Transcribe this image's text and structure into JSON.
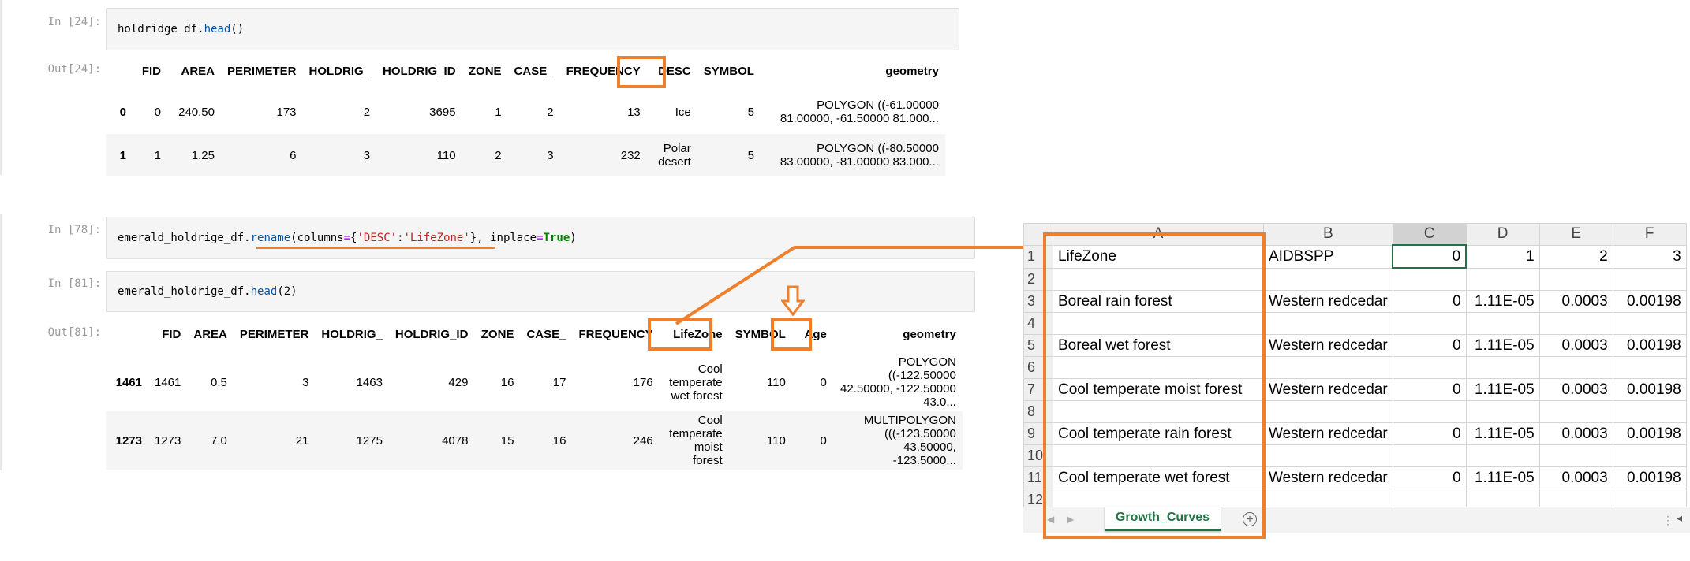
{
  "colors": {
    "highlight": "#f07f2b",
    "excel_green": "#217346"
  },
  "cell1": {
    "in_prompt": "In [24]:",
    "code": {
      "obj": "holdridge_df",
      "dot": ".",
      "fn": "head",
      "args": "()"
    },
    "out_prompt": "Out[24]:",
    "table": {
      "columns": [
        "",
        "FID",
        "AREA",
        "PERIMETER",
        "HOLDRIG_",
        "HOLDRIG_ID",
        "ZONE",
        "CASE_",
        "FREQUENCY",
        "DESC",
        "SYMBOL",
        "geometry"
      ],
      "rows": [
        {
          "index": "0",
          "cells": [
            "0",
            "240.50",
            "173",
            "2",
            "3695",
            "1",
            "2",
            "13",
            "Ice",
            "5",
            "POLYGON ((-61.00000 81.00000, -61.50000 81.000..."
          ]
        },
        {
          "index": "1",
          "cells": [
            "1",
            "1.25",
            "6",
            "3",
            "110",
            "2",
            "3",
            "232",
            "Polar desert",
            "5",
            "POLYGON ((-80.50000 83.00000, -81.00000 83.000..."
          ]
        }
      ]
    }
  },
  "cell2": {
    "in_prompt": "In [78]:",
    "code": {
      "obj": "emerald_holdrige_df",
      "dot": ".",
      "fn": "rename",
      "p1": "(columns",
      "eq": "=",
      "b1": "{",
      "s1": "'DESC'",
      "colon": ":",
      "s2": "'LifeZone'",
      "b2": "}",
      "p2": ", inplace",
      "eq2": "=",
      "kw": "True",
      "p3": ")"
    }
  },
  "cell3": {
    "in_prompt": "In [81]:",
    "code": {
      "obj": "emerald_holdrige_df",
      "dot": ".",
      "fn": "head",
      "args": "(2)"
    },
    "out_prompt": "Out[81]:",
    "table": {
      "columns": [
        "",
        "FID",
        "AREA",
        "PERIMETER",
        "HOLDRIG_",
        "HOLDRIG_ID",
        "ZONE",
        "CASE_",
        "FREQUENCY",
        "LifeZone",
        "SYMBOL",
        "Age",
        "geometry"
      ],
      "rows": [
        {
          "index": "1461",
          "cells": [
            "1461",
            "0.5",
            "3",
            "1463",
            "429",
            "16",
            "17",
            "176",
            "Cool temperate wet forest",
            "110",
            "0",
            "POLYGON ((-122.50000 42.50000, -122.50000 43.0..."
          ]
        },
        {
          "index": "1273",
          "cells": [
            "1273",
            "7.0",
            "21",
            "1275",
            "4078",
            "15",
            "16",
            "246",
            "Cool temperate moist forest",
            "110",
            "0",
            "MULTIPOLYGON (((-123.50000 43.50000, -123.5000..."
          ]
        }
      ]
    }
  },
  "excel": {
    "col_headers": [
      "",
      "A",
      "B",
      "C",
      "D",
      "E",
      "F"
    ],
    "rows": [
      {
        "num": "1",
        "cells": [
          "LifeZone",
          "AIDBSPP",
          "0",
          "1",
          "2",
          "3"
        ]
      },
      {
        "num": "2",
        "cells": [
          "",
          "",
          "",
          "",
          "",
          ""
        ]
      },
      {
        "num": "3",
        "cells": [
          "Boreal rain forest",
          "Western redcedar",
          "0",
          "1.11E-05",
          "0.0003",
          "0.00198"
        ]
      },
      {
        "num": "4",
        "cells": [
          "",
          "",
          "",
          "",
          "",
          ""
        ]
      },
      {
        "num": "5",
        "cells": [
          "Boreal wet forest",
          "Western redcedar",
          "0",
          "1.11E-05",
          "0.0003",
          "0.00198"
        ]
      },
      {
        "num": "6",
        "cells": [
          "",
          "",
          "",
          "",
          "",
          ""
        ]
      },
      {
        "num": "7",
        "cells": [
          "Cool temperate moist forest",
          "Western redcedar",
          "0",
          "1.11E-05",
          "0.0003",
          "0.00198"
        ]
      },
      {
        "num": "8",
        "cells": [
          "",
          "",
          "",
          "",
          "",
          ""
        ]
      },
      {
        "num": "9",
        "cells": [
          "Cool temperate rain forest",
          "Western redcedar",
          "0",
          "1.11E-05",
          "0.0003",
          "0.00198"
        ]
      },
      {
        "num": "10",
        "cells": [
          "",
          "",
          "",
          "",
          "",
          ""
        ]
      },
      {
        "num": "11",
        "cells": [
          "Cool temperate wet forest",
          "Western redcedar",
          "0",
          "1.11E-05",
          "0.0003",
          "0.00198"
        ]
      },
      {
        "num": "12",
        "cells": [
          "",
          "",
          "",
          "",
          "",
          ""
        ]
      }
    ],
    "sheet_tab": "Growth_Curves",
    "add_sheet_icon": "plus-circle-icon"
  }
}
